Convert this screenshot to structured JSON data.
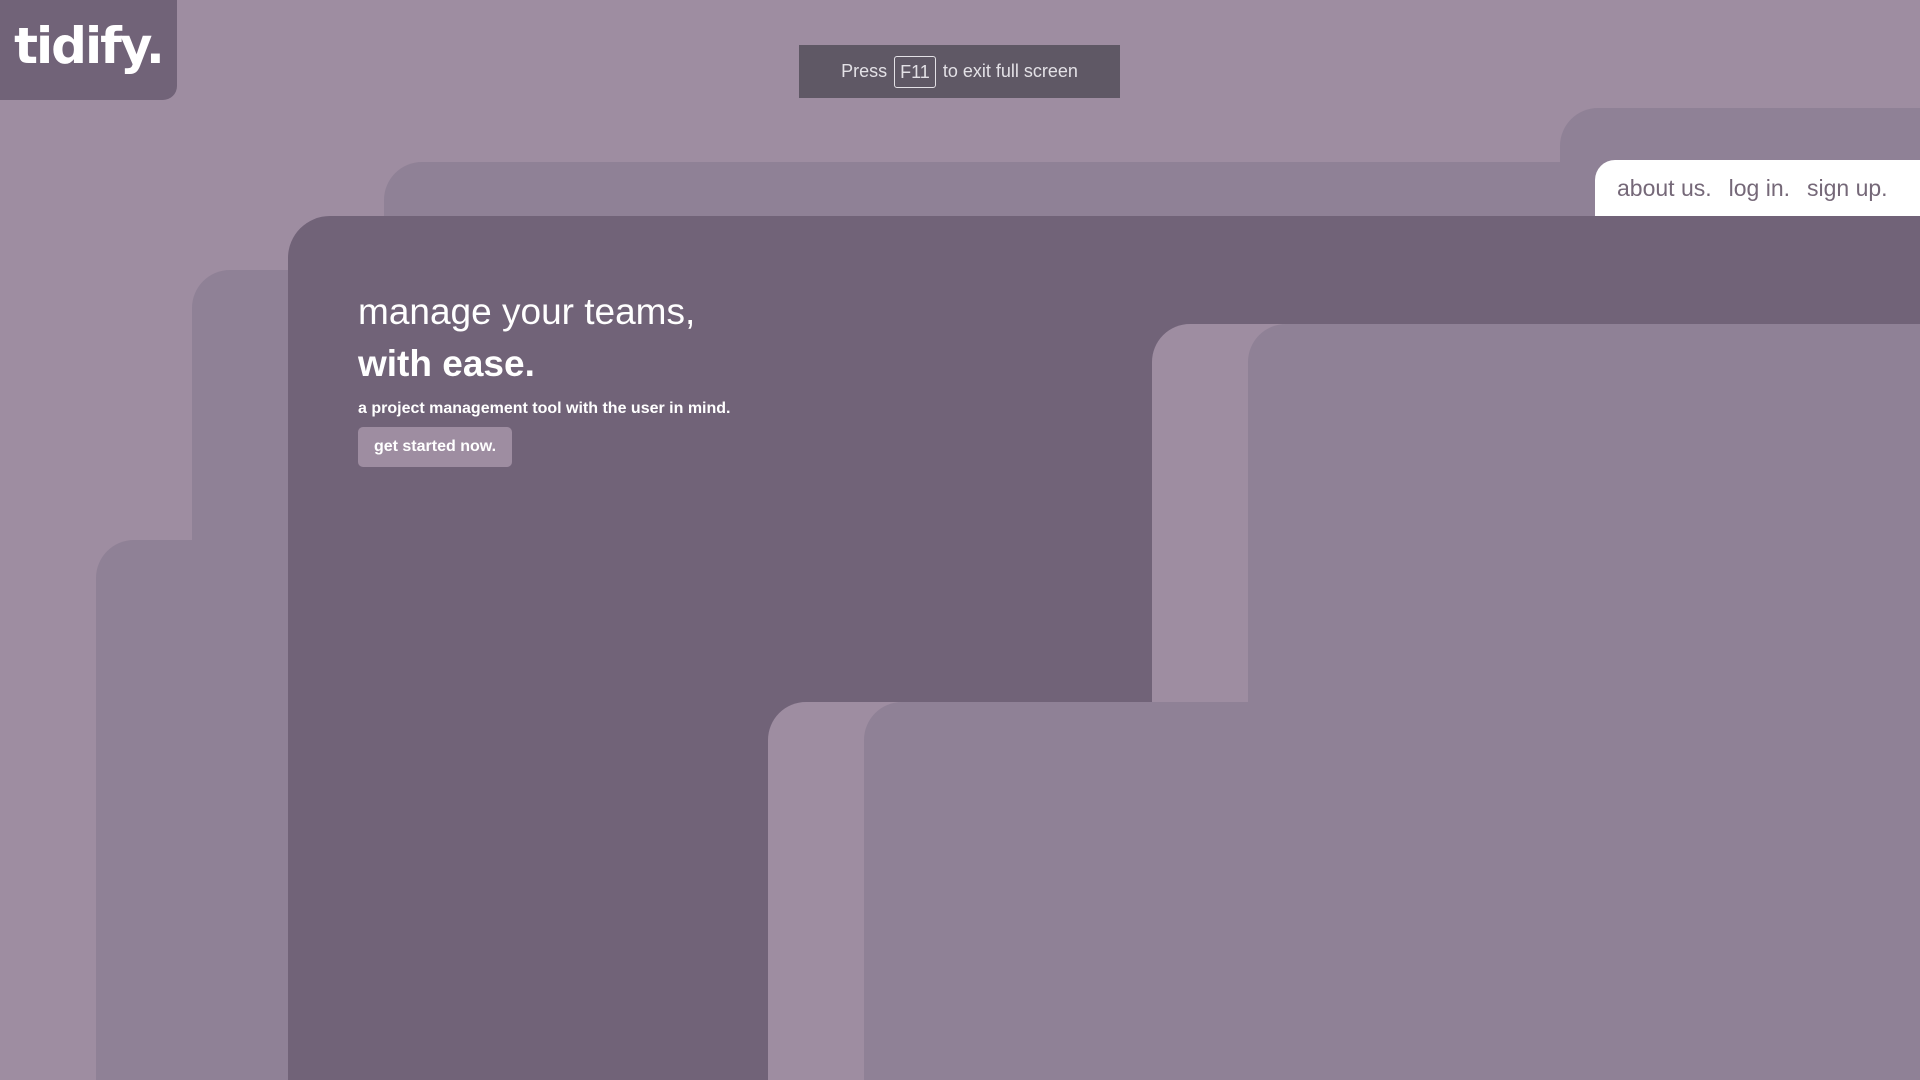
{
  "brand": {
    "logo": "tidify."
  },
  "fullscreen_notice": {
    "prefix": "Press",
    "key": "F11",
    "suffix": "to exit full screen"
  },
  "nav": {
    "items": [
      {
        "label": "about us."
      },
      {
        "label": "log in."
      },
      {
        "label": "sign up."
      }
    ]
  },
  "hero": {
    "line1": "manage your teams,",
    "line2": "with ease.",
    "subtitle": "a project management tool with the user in mind.",
    "cta_label": "get started now."
  },
  "colors": {
    "background": "#9E8DA1",
    "layer_mid": "#8F8196",
    "panel_dark": "#716378",
    "nav_background": "#FFFFFF",
    "nav_text": "#756878",
    "toast_background": "#5F5865"
  }
}
